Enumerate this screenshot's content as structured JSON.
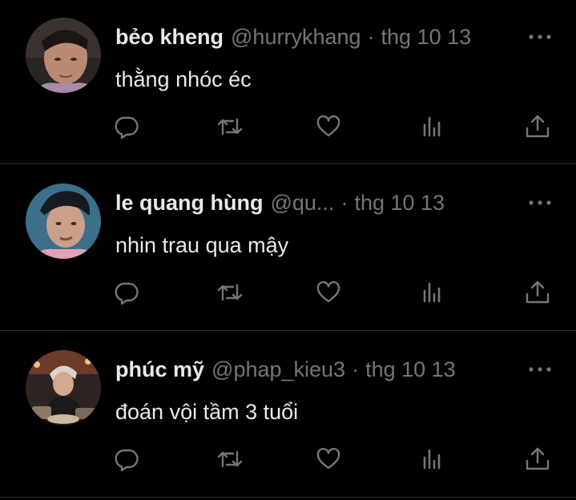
{
  "theme": {
    "background": "#000000",
    "text_primary": "#e7e9ea",
    "text_secondary": "#71767b",
    "divider": "#2f3336"
  },
  "tweets": [
    {
      "display_name": "bẻo kheng",
      "handle": "@hurrykhang",
      "separator": "·",
      "timestamp": "thg 10 13",
      "text": "thằng nhóc éc",
      "avatar_icon": "user-photo-avatar"
    },
    {
      "display_name": "le quang hùng",
      "handle": "@qu...",
      "separator": "·",
      "timestamp": "thg 10 13",
      "text": "nhin trau qua mậy",
      "avatar_icon": "user-photo-avatar"
    },
    {
      "display_name": "phúc mỹ",
      "handle": "@phap_kieu3",
      "separator": "·",
      "timestamp": "thg 10 13",
      "text": "đoán vội tầm 3 tuổi",
      "avatar_icon": "user-photo-avatar"
    }
  ],
  "action_icons": [
    "reply-icon",
    "retweet-icon",
    "like-icon",
    "views-icon",
    "share-icon"
  ],
  "more_icon": "more-options-icon"
}
